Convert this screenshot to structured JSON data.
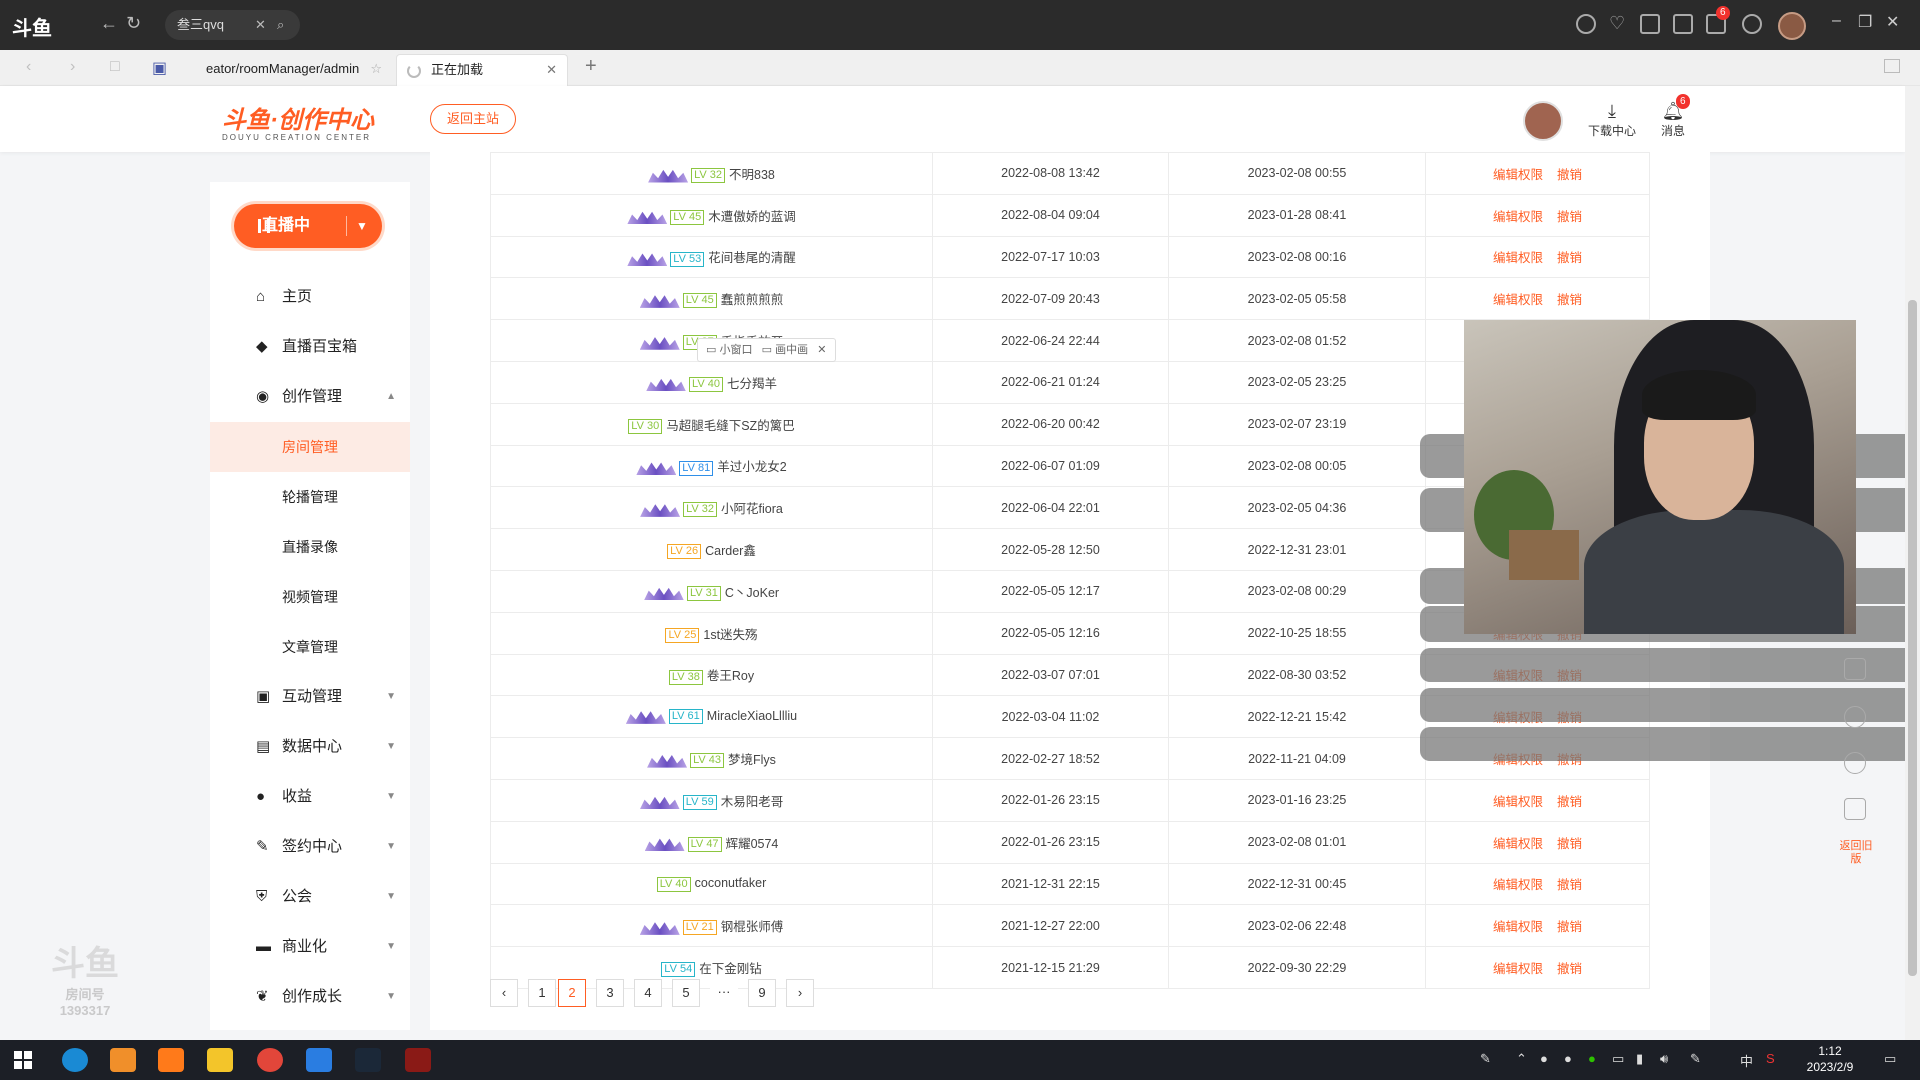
{
  "browser": {
    "logo": "斗鱼",
    "search_text": "叁三qvq",
    "tab1_label": "eator/roomManager/admin",
    "tab2_label": "正在加载",
    "titlebar_badge": "6"
  },
  "header": {
    "brand": "斗鱼·创作中心",
    "brand_sub": "DOUYU CREATION CENTER",
    "back_label": "返回主站",
    "download_label": "下载中心",
    "message_label": "消息",
    "message_badge": "6"
  },
  "sidebar": {
    "live_label": "直播中",
    "items": [
      {
        "icon": "home-icon",
        "glyph": "⌂",
        "label": "主页"
      },
      {
        "icon": "treasure-box-icon",
        "glyph": "◆",
        "label": "直播百宝箱"
      },
      {
        "icon": "creation-icon",
        "glyph": "◉",
        "label": "创作管理"
      },
      {
        "label": "房间管理"
      },
      {
        "label": "轮播管理"
      },
      {
        "label": "直播录像"
      },
      {
        "label": "视频管理"
      },
      {
        "label": "文章管理"
      },
      {
        "icon": "interaction-icon",
        "glyph": "▣",
        "label": "互动管理"
      },
      {
        "icon": "data-center-icon",
        "glyph": "▤",
        "label": "数据中心"
      },
      {
        "icon": "revenue-icon",
        "glyph": "●",
        "label": "收益"
      },
      {
        "icon": "contract-icon",
        "glyph": "✎",
        "label": "签约中心"
      },
      {
        "icon": "guild-icon",
        "glyph": "⛨",
        "label": "公会"
      },
      {
        "icon": "commerce-icon",
        "glyph": "▬",
        "label": "商业化"
      },
      {
        "icon": "growth-icon",
        "glyph": "❦",
        "label": "创作成长"
      }
    ]
  },
  "table": {
    "actions": {
      "edit": "编辑权限",
      "revoke": "撤销"
    },
    "rows": [
      {
        "lv": "LV 32",
        "lvc": "green",
        "crown": true,
        "name": "不明838",
        "d1": "2022-08-08 13:42",
        "d2": "2023-02-08 00:55"
      },
      {
        "lv": "LV 45",
        "lvc": "green",
        "crown": true,
        "name": "木遭傲娇的蓝调",
        "d1": "2022-08-04 09:04",
        "d2": "2023-01-28 08:41"
      },
      {
        "lv": "LV 53",
        "lvc": "teal",
        "crown": true,
        "name": "花间巷尾的清醒",
        "d1": "2022-07-17 10:03",
        "d2": "2023-02-08 00:16"
      },
      {
        "lv": "LV 45",
        "lvc": "green",
        "crown": true,
        "name": "蠢煎煎煎煎",
        "d1": "2022-07-09 20:43",
        "d2": "2023-02-05 05:58"
      },
      {
        "lv": "LV 37",
        "lvc": "green",
        "crown": true,
        "name": "手指手放开",
        "d1": "2022-06-24 22:44",
        "d2": "2023-02-08 01:52"
      },
      {
        "lv": "LV 40",
        "lvc": "green",
        "crown": true,
        "name": "七分羯羊",
        "d1": "2022-06-21 01:24",
        "d2": "2023-02-05 23:25"
      },
      {
        "lv": "LV 30",
        "lvc": "green",
        "crown": false,
        "name": "马超腿毛缝下SZ的篱巴",
        "d1": "2022-06-20 00:42",
        "d2": "2023-02-07 23:19"
      },
      {
        "lv": "LV 81",
        "lvc": "blue",
        "crown": true,
        "name": "羊过小龙女2",
        "d1": "2022-06-07 01:09",
        "d2": "2023-02-08 00:05"
      },
      {
        "lv": "LV 32",
        "lvc": "green",
        "crown": true,
        "name": "小阿花fiora",
        "d1": "2022-06-04 22:01",
        "d2": "2023-02-05 04:36"
      },
      {
        "lv": "LV 26",
        "lvc": "orange",
        "crown": false,
        "name": "Carder鑫",
        "d1": "2022-05-28 12:50",
        "d2": "2022-12-31 23:01"
      },
      {
        "lv": "LV 31",
        "lvc": "green",
        "crown": true,
        "name": "C丶JoKer",
        "d1": "2022-05-05 12:17",
        "d2": "2023-02-08 00:29"
      },
      {
        "lv": "LV 25",
        "lvc": "orange",
        "crown": false,
        "name": "1st迷失殇",
        "d1": "2022-05-05 12:16",
        "d2": "2022-10-25 18:55"
      },
      {
        "lv": "LV 38",
        "lvc": "green",
        "crown": false,
        "name": "卷王Roy",
        "d1": "2022-03-07 07:01",
        "d2": "2022-08-30 03:52"
      },
      {
        "lv": "LV 61",
        "lvc": "teal",
        "crown": true,
        "name": "MiracleXiaoLllliu",
        "d1": "2022-03-04 11:02",
        "d2": "2022-12-21 15:42"
      },
      {
        "lv": "LV 43",
        "lvc": "green",
        "crown": true,
        "name": "梦境Flys",
        "d1": "2022-02-27 18:52",
        "d2": "2022-11-21 04:09"
      },
      {
        "lv": "LV 59",
        "lvc": "teal",
        "crown": true,
        "name": "木易阳老哥",
        "d1": "2022-01-26 23:15",
        "d2": "2023-01-16 23:25"
      },
      {
        "lv": "LV 47",
        "lvc": "green",
        "crown": true,
        "name": "辉耀0574",
        "d1": "2022-01-26 23:15",
        "d2": "2023-02-08 01:01"
      },
      {
        "lv": "LV 40",
        "lvc": "green",
        "crown": false,
        "name": "coconutfaker",
        "d1": "2021-12-31 22:15",
        "d2": "2022-12-31 00:45"
      },
      {
        "lv": "LV 21",
        "lvc": "orange",
        "crown": true,
        "name": "钢棍张师傅",
        "d1": "2021-12-27 22:00",
        "d2": "2023-02-06 22:48"
      },
      {
        "lv": "LV 54",
        "lvc": "teal",
        "crown": false,
        "name": "在下金刚钻",
        "d1": "2021-12-15 21:29",
        "d2": "2022-09-30 22:29"
      }
    ]
  },
  "pagination": {
    "prev": "‹",
    "pages": [
      "1",
      "2",
      "3",
      "4",
      "5",
      "···",
      "9"
    ],
    "current": "2",
    "next": "›"
  },
  "pip": {
    "small_window": "小窗口",
    "picture_in_picture": "画中画"
  },
  "right_panel": {
    "return_old": "返回旧版"
  },
  "watermark": {
    "text": "1393317",
    "sub": "房间号"
  },
  "taskbar": {
    "time": "1:12",
    "date": "2023/2/9",
    "ime": "中"
  }
}
